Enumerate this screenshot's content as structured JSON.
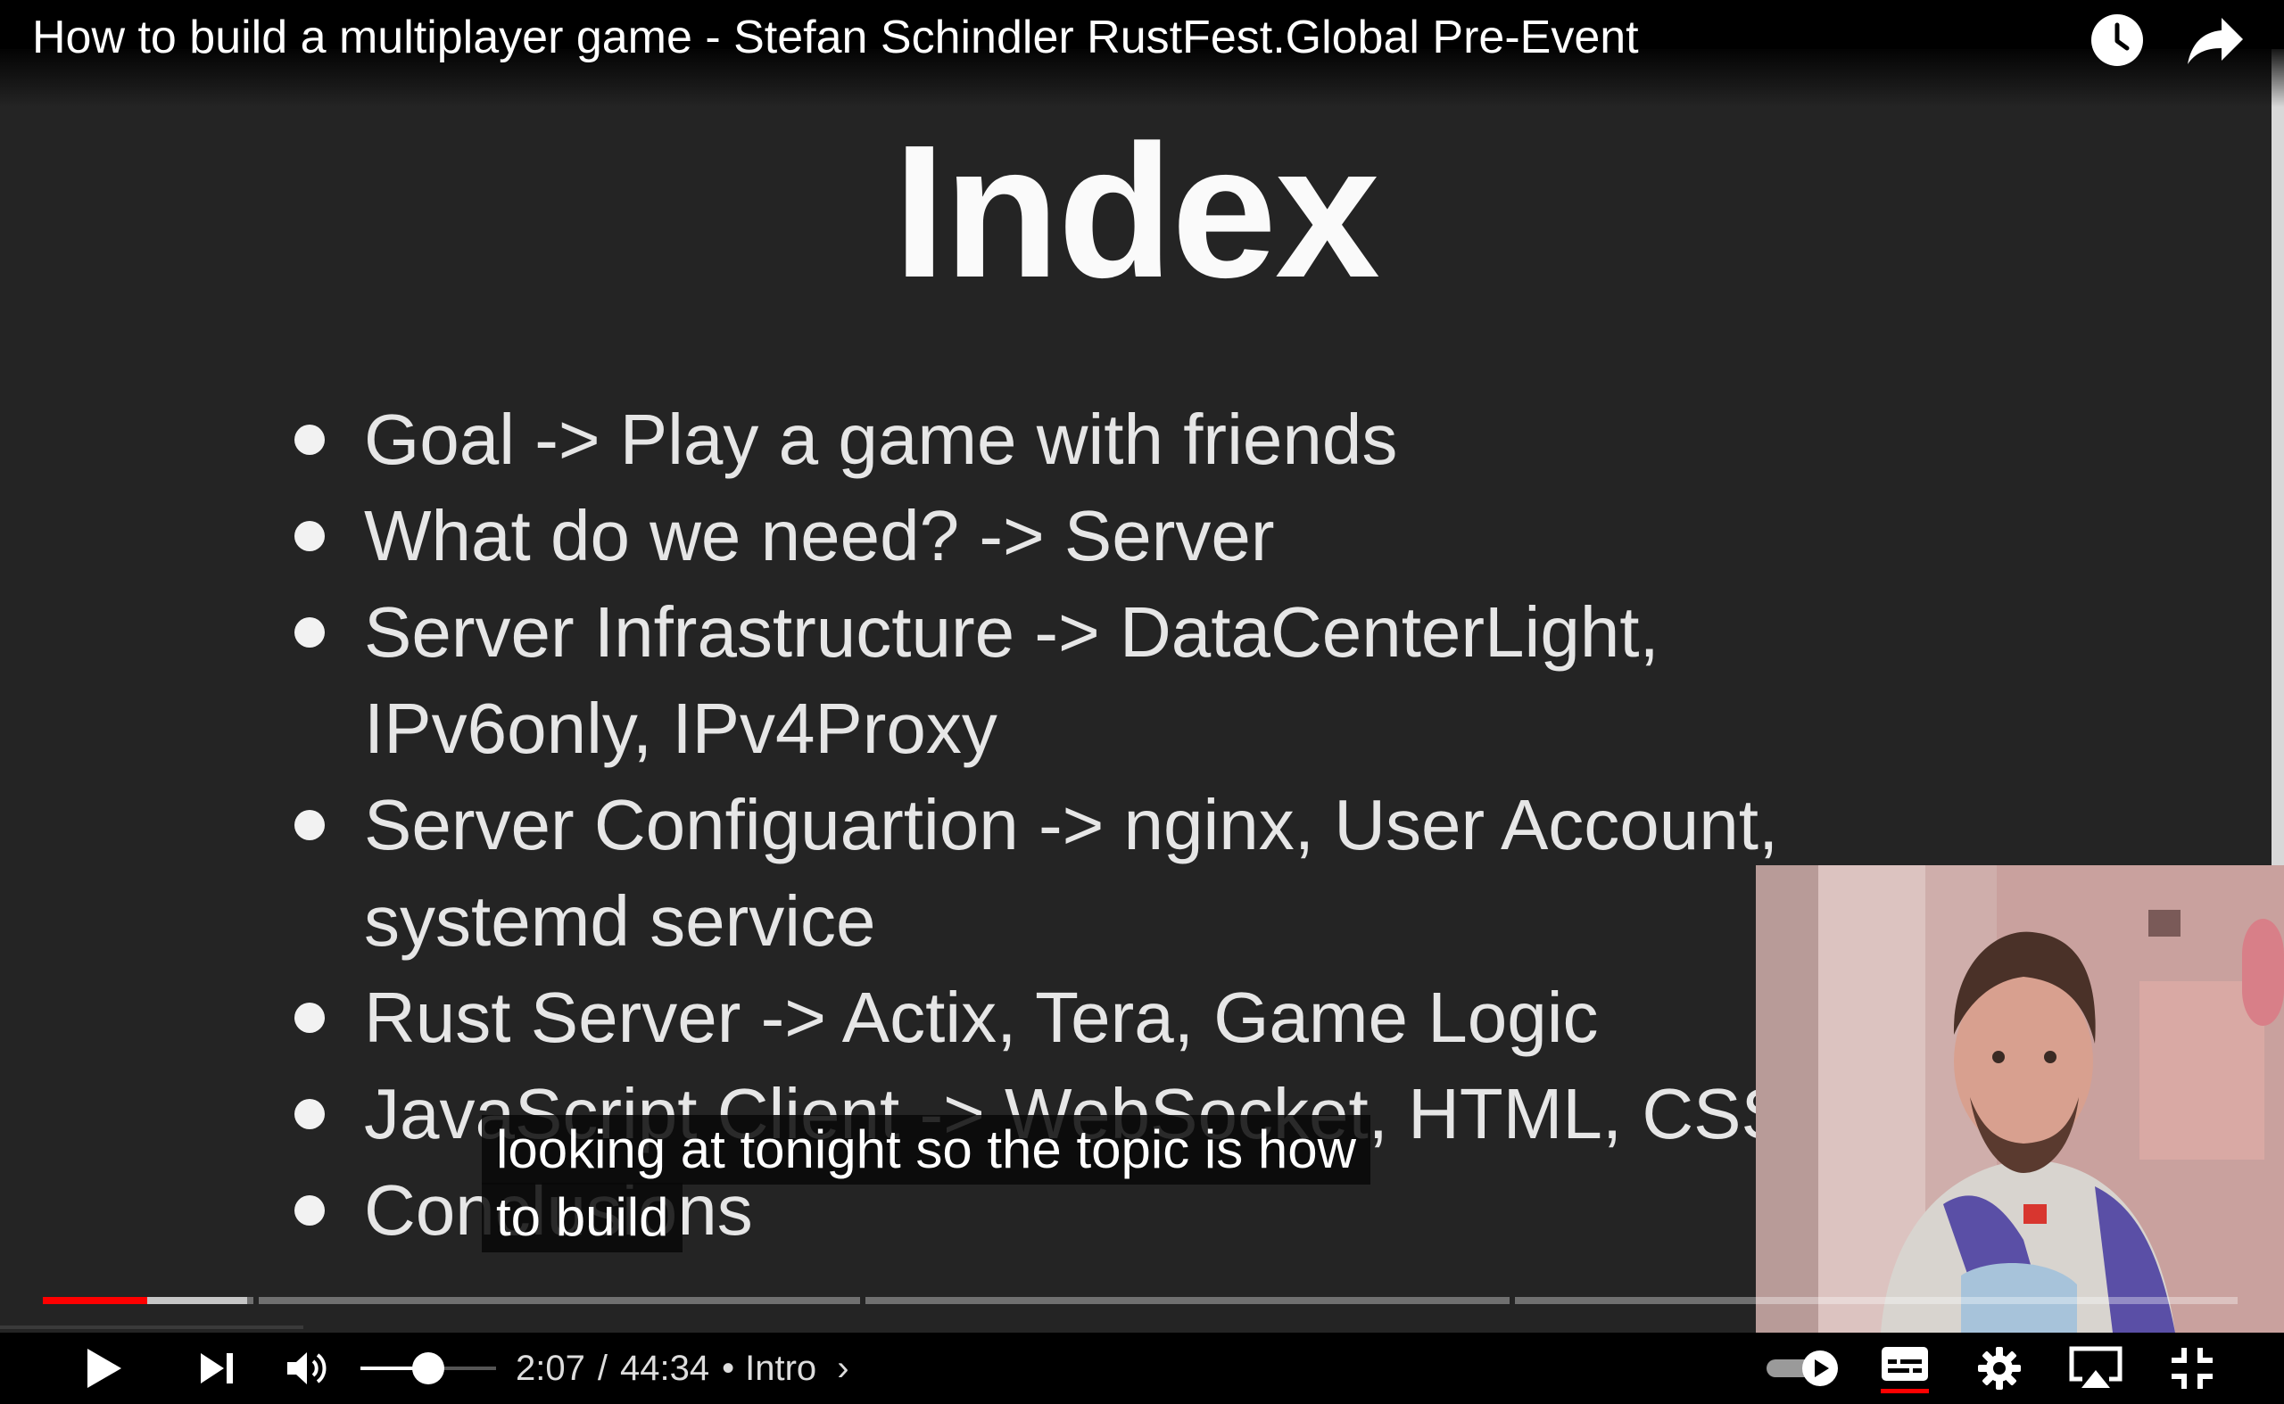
{
  "video": {
    "title": "How to build a multiplayer game - Stefan Schindler RustFest.Global Pre-Event"
  },
  "slide": {
    "title": "Index",
    "bullets": [
      {
        "lines": [
          "Goal -> Play a game with friends"
        ]
      },
      {
        "lines": [
          "What do we need? -> Server"
        ]
      },
      {
        "lines": [
          "Server Infrastructure -> DataCenterLight,",
          "IPv6only, IPv4Proxy"
        ]
      },
      {
        "lines": [
          "Server Configuartion -> nginx, User Account,",
          "systemd service"
        ]
      },
      {
        "lines": [
          "Rust Server -> Actix, Tera, Game Logic"
        ]
      },
      {
        "lines": [
          "JavaScript Client -> WebSocket, HTML, CSS"
        ]
      },
      {
        "lines": [
          "Conclusions"
        ]
      }
    ]
  },
  "captions": {
    "line1": "looking at tonight so the topic is how",
    "line2": "to build"
  },
  "player": {
    "current_time": "2:07",
    "duration": "44:34",
    "time_separator": "/",
    "chapter_prefix": "•",
    "chapter": "Intro",
    "chapter_chevron": "›",
    "progress_played_fraction": 0.0475,
    "progress_buffered_fraction": 0.093,
    "volume_fraction": 0.5,
    "autoplay_on": true,
    "subtitles_on": true
  },
  "icons": {
    "watch_later": "clock-icon",
    "share": "share-arrow-icon",
    "play": "play-icon",
    "next": "next-icon",
    "volume": "volume-icon",
    "autoplay": "autoplay-toggle-icon",
    "subtitles": "subtitles-icon",
    "settings": "gear-icon",
    "airplay": "airplay-icon",
    "exit_fullscreen": "exit-fullscreen-icon"
  },
  "colors": {
    "progress": "#ff0000",
    "slide_background": "#242424",
    "text": "#ffffff"
  }
}
